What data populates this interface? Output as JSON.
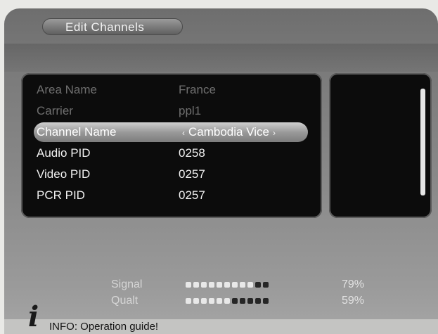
{
  "window": {
    "title": "Edit Channels"
  },
  "fields": [
    {
      "label": "Area Name",
      "value": "France",
      "state": "disabled"
    },
    {
      "label": "Carrier",
      "value": "ppl1",
      "state": "disabled"
    },
    {
      "label": "Channel Name",
      "value": "Cambodia Vice",
      "state": "selected",
      "left_arrow": "‹",
      "right_arrow": "›"
    },
    {
      "label": "Audio PID",
      "value": "0258",
      "state": "normal"
    },
    {
      "label": "Video PID",
      "value": "0257",
      "state": "normal"
    },
    {
      "label": "PCR PID",
      "value": "0257",
      "state": "normal"
    }
  ],
  "meters": {
    "signal": {
      "label": "Signal",
      "value_text": "79%",
      "level": 0.79
    },
    "quality": {
      "label": "Qualt",
      "value_text": "59%",
      "level": 0.59
    }
  },
  "info": {
    "icon": "info-icon",
    "glyph": "i",
    "text": "INFO: Operation guide!"
  },
  "colors": {
    "panel": "#0c0c0c",
    "highlight": "#b5b5b5",
    "text": "#f1f1f1"
  }
}
